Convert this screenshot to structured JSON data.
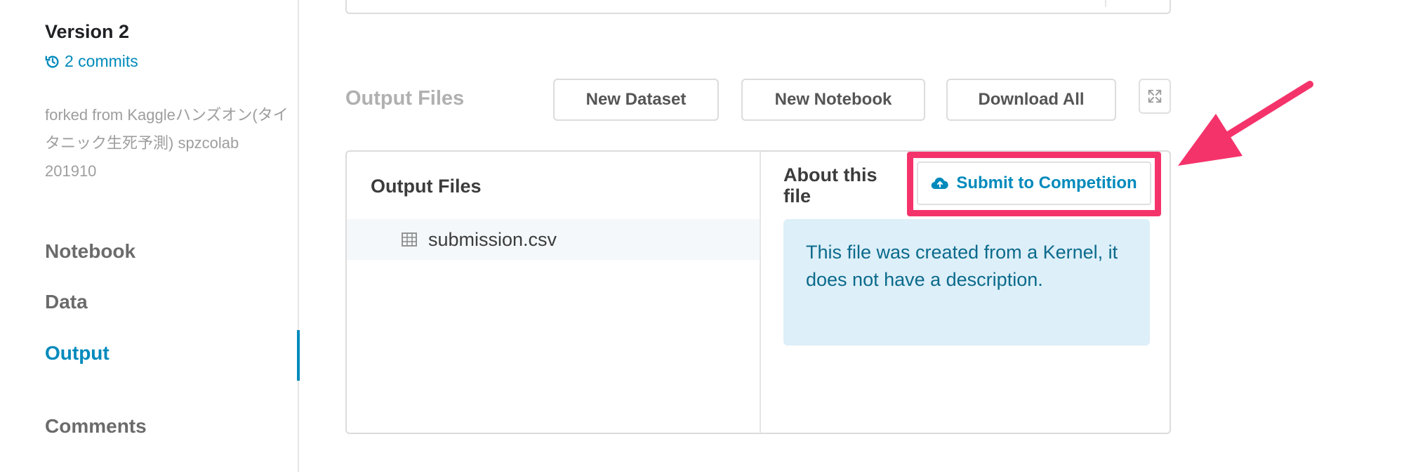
{
  "sidebar": {
    "version_title": "Version 2",
    "commits_label": "2 commits",
    "forked_from": "forked from Kaggleハンズオン(タイタニック生死予測) spzcolab 201910",
    "nav": [
      {
        "label": "Notebook"
      },
      {
        "label": "Data"
      },
      {
        "label": "Output"
      },
      {
        "label": "Comments"
      }
    ],
    "active_nav": "Output"
  },
  "toolbar": {
    "section_title": "Output Files",
    "new_dataset_label": "New Dataset",
    "new_notebook_label": "New Notebook",
    "download_all_label": "Download All"
  },
  "files_panel": {
    "heading": "Output Files",
    "files": [
      {
        "name": "submission.csv"
      }
    ]
  },
  "about_panel": {
    "heading": "About this file",
    "submit_label": "Submit to Competition",
    "description": "This file was created from a Kernel, it does not have a description."
  },
  "colors": {
    "accent": "#008abc",
    "highlight": "#f5336b",
    "info_bg": "#ddeff8"
  }
}
